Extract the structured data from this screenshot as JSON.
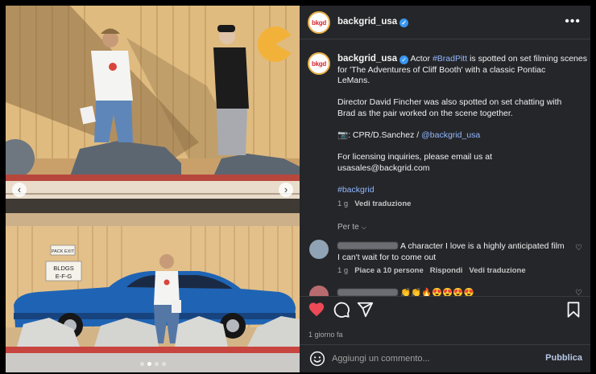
{
  "post": {
    "username": "backgrid_usa",
    "avatar_text": "bkgd",
    "verified_mark": "✓",
    "more_icon": "more-horizontal-icon"
  },
  "caption": {
    "username": "backgrid_usa",
    "text1": "Actor",
    "mention1": "#BradPitt",
    "text2": "is spotted on set filming scenes",
    "line2": "for 'The Adventures of Cliff Booth' with a classic Pontiac",
    "line3": "LeMans.",
    "line4": "Director David Fincher was also spotted on set chatting with",
    "line5": "Brad as the pair worked on the scene together.",
    "credit_prefix": "📷: CPR/D.Sanchez /",
    "credit_tag": "@backgrid_usa",
    "line7": "For licensing inquiries, please email us at",
    "line8": "usasales@backgrid.com",
    "hashtag": "#backgrid",
    "time": "1 g",
    "see_translation": "Vedi traduzione"
  },
  "per_te": "Per te",
  "comments": [
    {
      "text_line1": "A character I love is a highly anticipated film",
      "text_line2": "I can't wait for to come out",
      "time": "1 g",
      "likes": "Piace a 10 persone",
      "reply": "Rispondi",
      "see_translation": "Vedi traduzione"
    },
    {
      "text": "👏👏🔥😍😍😍😍"
    }
  ],
  "timestamp": "1 giorno fa",
  "add_comment": {
    "placeholder": "Aggiungi un commento...",
    "publish_label": "Pubblica"
  },
  "carousel": {
    "prev_glyph": "‹",
    "next_glyph": "›",
    "dots": 4,
    "active_dot": 2
  },
  "scene": {
    "sign_top": "PACK EXIT",
    "sign_line1": "BLDGS",
    "sign_line2": "E-F-G"
  },
  "colors": {
    "panel_bg": "#25262a",
    "like_red": "#ed4956",
    "link_blue": "#92b8ff",
    "verified_blue": "#3897f0"
  }
}
